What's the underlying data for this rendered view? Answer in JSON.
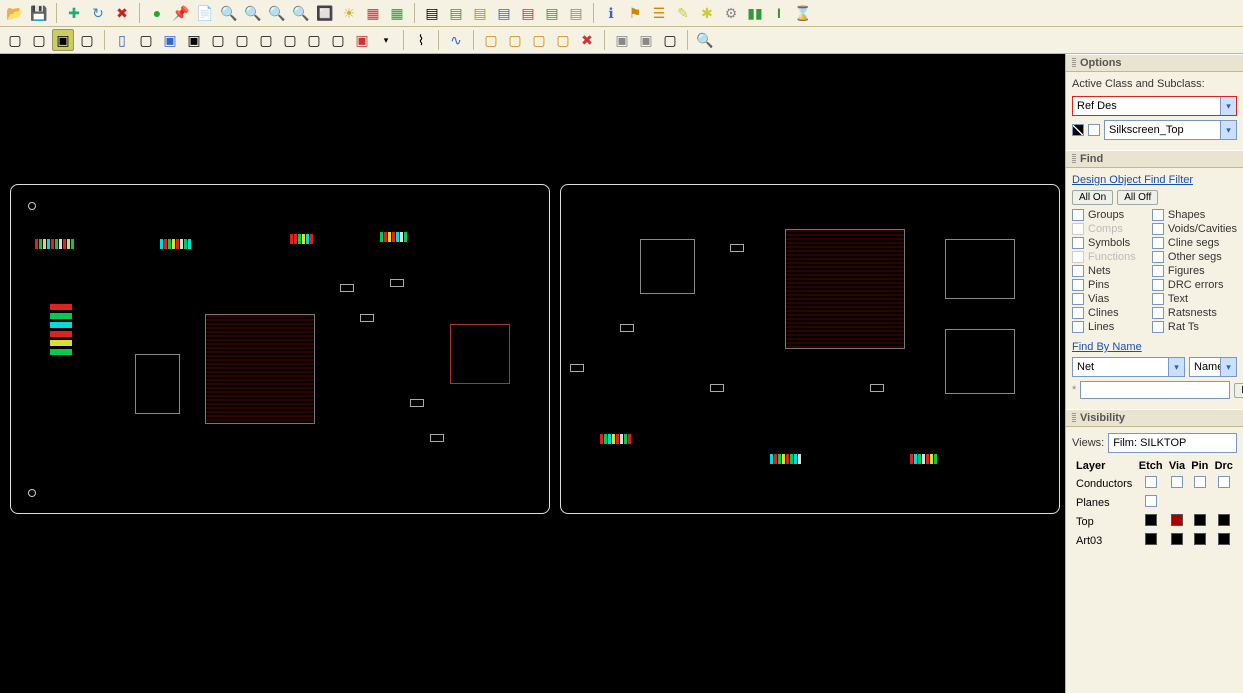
{
  "toolbar1": {
    "icons": [
      "folder-open",
      "save",
      "sep",
      "plus",
      "rotate",
      "delete",
      "sep",
      "dot-green",
      "pin",
      "document",
      "zoom-fit",
      "zoom-in",
      "zoom-out",
      "zoom-window",
      "zoom-previous",
      "sun",
      "layers",
      "grid",
      "sep",
      "table1",
      "table2",
      "table3",
      "table4",
      "table5",
      "table6",
      "table7",
      "sep",
      "info",
      "flag",
      "bars-orange",
      "wand",
      "star",
      "gear",
      "bars-green",
      "hourglass",
      "clock"
    ]
  },
  "toolbar2": {
    "icons": [
      "a1",
      "a2",
      "a3",
      "a4",
      "sep",
      "b1",
      "b2",
      "b3",
      "b4",
      "b5",
      "b6",
      "b7",
      "b8",
      "b9",
      "b10",
      "b11",
      "b12",
      "sep",
      "c1",
      "sep",
      "d1",
      "sep",
      "e1",
      "e2",
      "e3",
      "e4",
      "e5",
      "e6",
      "sep",
      "f1",
      "f2",
      "f3",
      "sep",
      "search"
    ]
  },
  "options": {
    "title": "Options",
    "section_label": "Active Class and Subclass:",
    "class_value": "Ref Des",
    "subclass_value": "Silkscreen_Top"
  },
  "find": {
    "title": "Find",
    "filter_label": "Design Object Find Filter",
    "all_on": "All On",
    "all_off": "All Off",
    "left": [
      {
        "label": "Groups",
        "enabled": true
      },
      {
        "label": "Comps",
        "enabled": false
      },
      {
        "label": "Symbols",
        "enabled": true
      },
      {
        "label": "Functions",
        "enabled": false
      },
      {
        "label": "Nets",
        "enabled": true
      },
      {
        "label": "Pins",
        "enabled": true
      },
      {
        "label": "Vias",
        "enabled": true
      },
      {
        "label": "Clines",
        "enabled": true
      },
      {
        "label": "Lines",
        "enabled": true
      }
    ],
    "right": [
      {
        "label": "Shapes",
        "enabled": true
      },
      {
        "label": "Voids/Cavities",
        "enabled": true
      },
      {
        "label": "Cline segs",
        "enabled": true
      },
      {
        "label": "Other segs",
        "enabled": true
      },
      {
        "label": "Figures",
        "enabled": true
      },
      {
        "label": "DRC errors",
        "enabled": true
      },
      {
        "label": "Text",
        "enabled": true
      },
      {
        "label": "Ratsnests",
        "enabled": true
      },
      {
        "label": "Rat Ts",
        "enabled": true
      }
    ],
    "find_by_name": "Find By Name",
    "type_value": "Net",
    "name_label": "Name",
    "more": "More..."
  },
  "visibility": {
    "title": "Visibility",
    "views_label": "Views:",
    "film_value": "Film: SILKTOP",
    "layer_label": "Layer",
    "cols": [
      "Etch",
      "Via",
      "Pin",
      "Drc"
    ],
    "rows": [
      {
        "name": "Conductors",
        "checks": [
          true,
          true,
          true,
          true
        ]
      },
      {
        "name": "Planes",
        "checks": [
          false
        ]
      },
      {
        "name": "Top",
        "colors": [
          "#000",
          "#a00",
          "#000",
          "#000"
        ]
      },
      {
        "name": "Art03",
        "colors": [
          "#000",
          "#000",
          "#000",
          "#000"
        ]
      }
    ]
  },
  "colors": {
    "green": "#2a892a",
    "blue": "#3a6fb0",
    "red": "#c83030",
    "orange": "#d88b20",
    "yellow": "#d8c030",
    "cyan": "#30a8c8",
    "gray": "#888"
  }
}
